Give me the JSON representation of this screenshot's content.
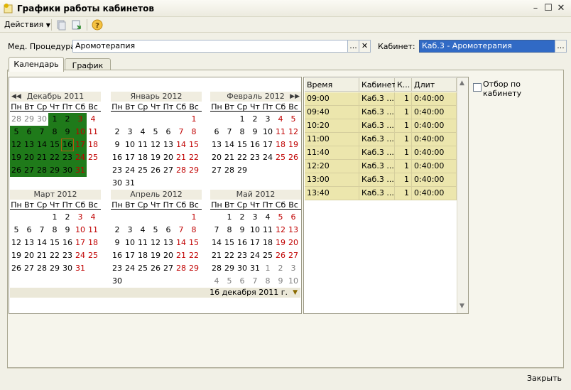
{
  "window": {
    "title": "Графики работы кабинетов",
    "controls": [
      "minimize",
      "maximize",
      "close"
    ]
  },
  "toolbar": {
    "actions_label": "Действия",
    "icons": [
      "document-stack-icon",
      "refresh-icon",
      "help-icon"
    ]
  },
  "form": {
    "procedure_label": "Мед. Процедура:",
    "procedure_value": "Аромотерапия",
    "cabinet_label": "Кабинет:",
    "cabinet_value": "Каб.3 - Аромотерапия",
    "ellipsis": "...",
    "clear": "✕",
    "accent_color": "#316ac5"
  },
  "tabs": [
    {
      "label": "Календарь",
      "active": true
    },
    {
      "label": "График",
      "active": false
    }
  ],
  "day_names": [
    "Пн",
    "Вт",
    "Ср",
    "Чт",
    "Пт",
    "Сб",
    "Вс"
  ],
  "calendar": {
    "months": [
      {
        "title": "Декабрь 2011",
        "weeks": [
          [
            "28",
            "29",
            "30",
            "1",
            "2",
            "3",
            "4"
          ],
          [
            "5",
            "6",
            "7",
            "8",
            "9",
            "10",
            "11"
          ],
          [
            "12",
            "13",
            "14",
            "15",
            "16",
            "17",
            "18"
          ],
          [
            "19",
            "20",
            "21",
            "22",
            "23",
            "24",
            "25"
          ],
          [
            "26",
            "27",
            "28",
            "29",
            "30",
            "31",
            ""
          ]
        ]
      },
      {
        "title": "Январь 2012",
        "weeks": [
          [
            "",
            "",
            "",
            "",
            "",
            "",
            "1"
          ],
          [
            "2",
            "3",
            "4",
            "5",
            "6",
            "7",
            "8"
          ],
          [
            "9",
            "10",
            "11",
            "12",
            "13",
            "14",
            "15"
          ],
          [
            "16",
            "17",
            "18",
            "19",
            "20",
            "21",
            "22"
          ],
          [
            "23",
            "24",
            "25",
            "26",
            "27",
            "28",
            "29"
          ],
          [
            "30",
            "31",
            "",
            "",
            "",
            "",
            ""
          ]
        ]
      },
      {
        "title": "Февраль 2012",
        "weeks": [
          [
            "",
            "",
            "1",
            "2",
            "3",
            "4",
            "5"
          ],
          [
            "6",
            "7",
            "8",
            "9",
            "10",
            "11",
            "12"
          ],
          [
            "13",
            "14",
            "15",
            "16",
            "17",
            "18",
            "19"
          ],
          [
            "20",
            "21",
            "22",
            "23",
            "24",
            "25",
            "26"
          ],
          [
            "27",
            "28",
            "29",
            "",
            "",
            "",
            ""
          ]
        ]
      },
      {
        "title": "Март 2012",
        "weeks": [
          [
            "",
            "",
            "",
            "1",
            "2",
            "3",
            "4"
          ],
          [
            "5",
            "6",
            "7",
            "8",
            "9",
            "10",
            "11"
          ],
          [
            "12",
            "13",
            "14",
            "15",
            "16",
            "17",
            "18"
          ],
          [
            "19",
            "20",
            "21",
            "22",
            "23",
            "24",
            "25"
          ],
          [
            "26",
            "27",
            "28",
            "29",
            "30",
            "31",
            ""
          ]
        ]
      },
      {
        "title": "Апрель 2012",
        "weeks": [
          [
            "",
            "",
            "",
            "",
            "",
            "",
            "1"
          ],
          [
            "2",
            "3",
            "4",
            "5",
            "6",
            "7",
            "8"
          ],
          [
            "9",
            "10",
            "11",
            "12",
            "13",
            "14",
            "15"
          ],
          [
            "16",
            "17",
            "18",
            "19",
            "20",
            "21",
            "22"
          ],
          [
            "23",
            "24",
            "25",
            "26",
            "27",
            "28",
            "29"
          ],
          [
            "30",
            "",
            "",
            "",
            "",
            "",
            ""
          ]
        ]
      },
      {
        "title": "Май 2012",
        "weeks": [
          [
            "",
            "1",
            "2",
            "3",
            "4",
            "5",
            "6"
          ],
          [
            "7",
            "8",
            "9",
            "10",
            "11",
            "12",
            "13"
          ],
          [
            "14",
            "15",
            "16",
            "17",
            "18",
            "19",
            "20"
          ],
          [
            "21",
            "22",
            "23",
            "24",
            "25",
            "26",
            "27"
          ],
          [
            "28",
            "29",
            "30",
            "31",
            "1",
            "2",
            "3"
          ],
          [
            "4",
            "5",
            "6",
            "7",
            "8",
            "9",
            "10"
          ]
        ]
      }
    ],
    "current_date": "16 декабря 2011 г.",
    "selected_color": "#1f7a1a",
    "weekend_color": "#c00000"
  },
  "grid": {
    "columns": [
      "Время",
      "Кабинет",
      "К...",
      "Длит"
    ],
    "rows": [
      [
        "09:00",
        "Каб.3 ...",
        "1",
        "0:40:00"
      ],
      [
        "09:40",
        "Каб.3 ...",
        "1",
        "0:40:00"
      ],
      [
        "10:20",
        "Каб.3 ...",
        "1",
        "0:40:00"
      ],
      [
        "11:00",
        "Каб.3 ...",
        "1",
        "0:40:00"
      ],
      [
        "11:40",
        "Каб.3 ...",
        "1",
        "0:40:00"
      ],
      [
        "12:20",
        "Каб.3 ...",
        "1",
        "0:40:00"
      ],
      [
        "13:00",
        "Каб.3 ...",
        "1",
        "0:40:00"
      ],
      [
        "13:40",
        "Каб.3 ...",
        "1",
        "0:40:00"
      ]
    ],
    "row_color": "#ece6ad"
  },
  "filter": {
    "label": "Отбор по кабинету",
    "checked": false
  },
  "footer": {
    "close_label": "Закрыть"
  }
}
